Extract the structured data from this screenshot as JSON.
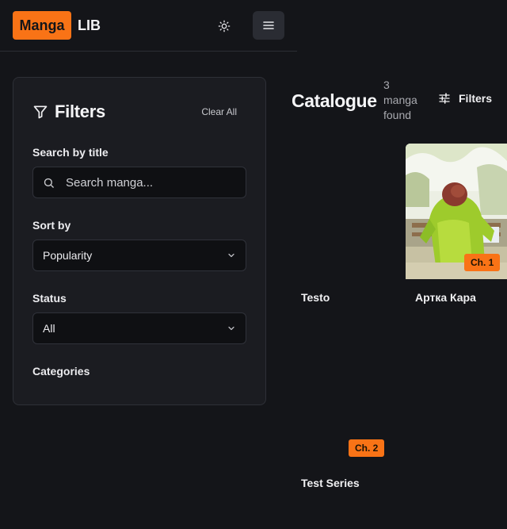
{
  "header": {
    "logo_highlight": "Manga",
    "logo_suffix": "LIB",
    "theme_icon": "sun-icon",
    "menu_icon": "hamburger-menu-icon"
  },
  "filters": {
    "title": "Filters",
    "clear_all": "Clear All",
    "search_label": "Search by title",
    "search_placeholder": "Search manga...",
    "sort_label": "Sort by",
    "sort_value": "Popularity",
    "status_label": "Status",
    "status_value": "All",
    "categories_label": "Categories"
  },
  "catalogue": {
    "title": "Catalogue",
    "count": "3 manga found",
    "filters_button": "Filters",
    "items": [
      {
        "title": "Testo",
        "chapter": ""
      },
      {
        "title": "Артка Кара",
        "chapter": "Ch. 1"
      },
      {
        "title": "Test Series",
        "chapter": "Ch. 2"
      }
    ]
  },
  "colors": {
    "accent": "#f97316",
    "background": "#141519",
    "panel": "#1b1c21"
  }
}
